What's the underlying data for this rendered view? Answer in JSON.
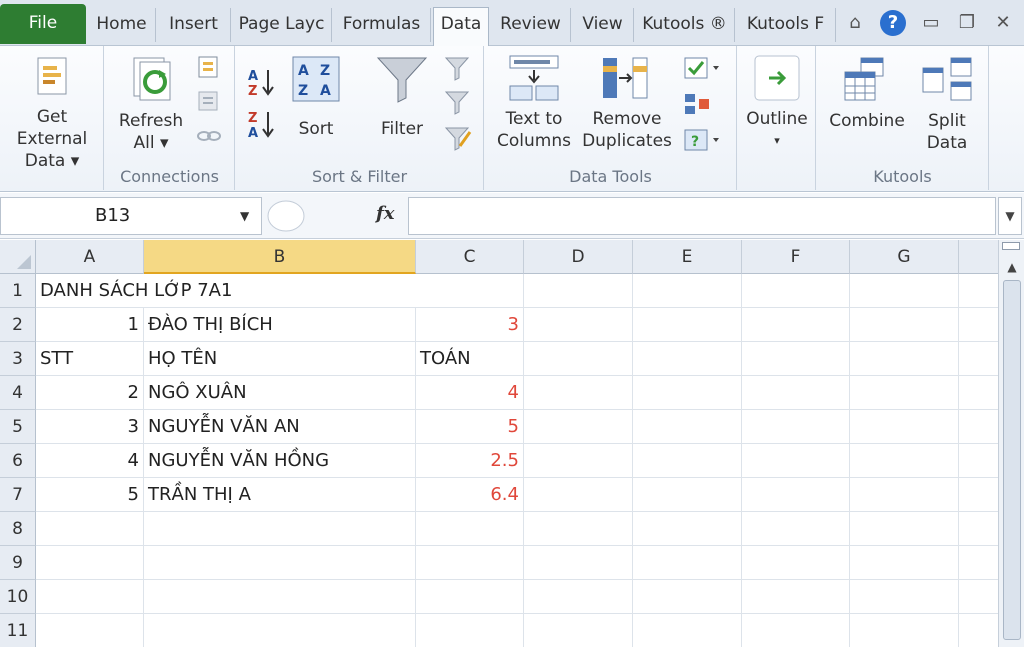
{
  "tabs": [
    {
      "label": "File"
    },
    {
      "label": "Home"
    },
    {
      "label": "Insert"
    },
    {
      "label": "Page Layc"
    },
    {
      "label": "Formulas"
    },
    {
      "label": "Data"
    },
    {
      "label": "Review"
    },
    {
      "label": "View"
    },
    {
      "label": "Kutools ®"
    },
    {
      "label": "Kutools F"
    }
  ],
  "active_tab": "Data",
  "ribbon": {
    "get_external": {
      "line1": "Get External",
      "line2": "Data ▾"
    },
    "refresh": {
      "line1": "Refresh",
      "line2": "All ▾"
    },
    "sort": {
      "label": "Sort"
    },
    "filter": {
      "label": "Filter"
    },
    "text_to_columns": {
      "line1": "Text to",
      "line2": "Columns"
    },
    "remove_duplicates": {
      "line1": "Remove",
      "line2": "Duplicates"
    },
    "outline": {
      "label": "Outline",
      "caret": "▾"
    },
    "combine": {
      "label": "Combine"
    },
    "split_data": {
      "line1": "Split",
      "line2": "Data"
    },
    "groups": {
      "connections": "Connections",
      "sort_filter": "Sort & Filter",
      "data_tools": "Data Tools",
      "kutools": "Kutools"
    }
  },
  "formula_bar": {
    "name_box": "B13",
    "fx": "fx",
    "content": ""
  },
  "columns": [
    "A",
    "B",
    "C",
    "D",
    "E",
    "F",
    "G"
  ],
  "selected_column": "B",
  "rows": [
    {
      "n": "1",
      "A": "DANH SÁCH LỚP 7A1",
      "B": "",
      "C": ""
    },
    {
      "n": "2",
      "A": "1",
      "B": "ĐÀO THỊ BÍCH",
      "C": "3"
    },
    {
      "n": "3",
      "A": "STT",
      "B": "HỌ TÊN",
      "C": "TOÁN"
    },
    {
      "n": "4",
      "A": "2",
      "B": "NGÔ XUÂN",
      "C": "4"
    },
    {
      "n": "5",
      "A": "3",
      "B": "NGUYỄN VĂN AN",
      "C": "5"
    },
    {
      "n": "6",
      "A": "4",
      "B": "NGUYỄN VĂN HỒNG",
      "C": "2.5"
    },
    {
      "n": "7",
      "A": "5",
      "B": "TRẦN THỊ A",
      "C": "6.4"
    },
    {
      "n": "8",
      "A": "",
      "B": "",
      "C": ""
    },
    {
      "n": "9",
      "A": "",
      "B": "",
      "C": ""
    },
    {
      "n": "10",
      "A": "",
      "B": "",
      "C": ""
    },
    {
      "n": "11",
      "A": "",
      "B": "",
      "C": ""
    }
  ],
  "colors": {
    "file_tab": "#2e7d32",
    "score_text": "#e0473a",
    "selected_header": "#f5d985"
  }
}
